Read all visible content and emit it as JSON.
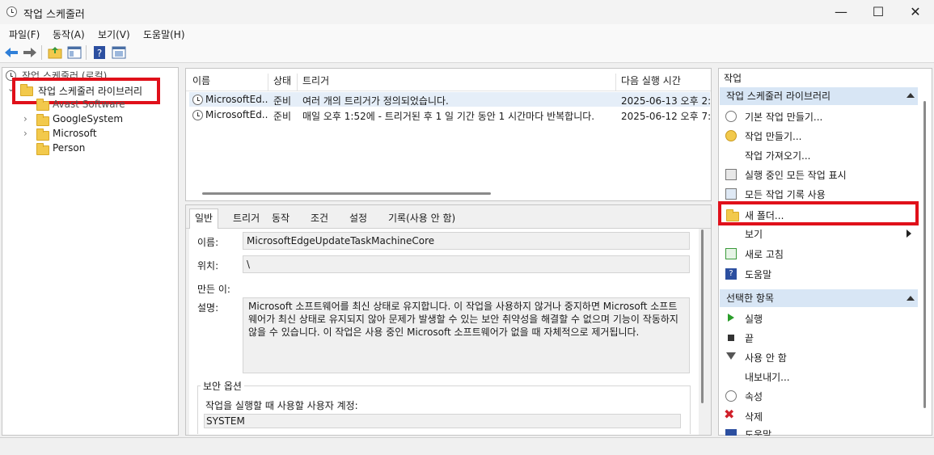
{
  "window": {
    "title": "작업 스케줄러",
    "controls": {
      "minimize": "—",
      "maximize": "☐",
      "close": "✕"
    }
  },
  "menu": [
    "파일(F)",
    "동작(A)",
    "보기(V)",
    "도움말(H)"
  ],
  "toolbar": {
    "icons": [
      "back-arrow-icon",
      "forward-arrow-icon",
      "folder-up-icon",
      "properties-icon",
      "help-icon",
      "view-icon"
    ]
  },
  "tree": {
    "root": "작업 스케줄러 (로컬)",
    "library": "작업 스케줄러 라이브러리",
    "children": [
      "Avast Software",
      "GoogleSystem",
      "Microsoft",
      "Person"
    ]
  },
  "task_list": {
    "columns": [
      "이름",
      "상태",
      "트리거",
      "다음 실행 시간"
    ],
    "rows": [
      {
        "name": "MicrosoftEd...",
        "status": "준비",
        "trigger": "여러 개의 트리거가 정의되었습니다.",
        "next_run": "2025-06-13 오후 2:2"
      },
      {
        "name": "MicrosoftEd...",
        "status": "준비",
        "trigger": "매일 오후 1:52에 - 트리거된 후 1 일 기간 동안 1 시간마다 반복합니다.",
        "next_run": "2025-06-12 오후 7:5"
      }
    ]
  },
  "detail": {
    "tabs": [
      "일반",
      "트리거",
      "동작",
      "조건",
      "설정",
      "기록(사용 안 함)"
    ],
    "labels": {
      "name": "이름:",
      "location": "위치:",
      "author": "만든 이:",
      "description": "설명:"
    },
    "name_value": "MicrosoftEdgeUpdateTaskMachineCore",
    "location_value": "\\",
    "description_value": "Microsoft 소프트웨어를 최신 상태로 유지합니다. 이 작업을 사용하지 않거나 중지하면 Microsoft 소프트웨어가 최신 상태로 유지되지 않아 문제가 발생할 수 있는 보안 취약성을 해결할 수 없으며 기능이 작동하지 않을 수 있습니다. 이 작업은 사용 중인 Microsoft 소프트웨어가 없을 때 자체적으로 제거됩니다.",
    "security_group": "보안 옵션",
    "run_as_label": "작업을 실행할 때 사용할 사용자 계정:",
    "run_as_value": "SYSTEM"
  },
  "actions": {
    "title": "작업",
    "section1": "작업 스케줄러 라이브러리",
    "items1": [
      "기본 작업 만들기...",
      "작업 만들기...",
      "작업 가져오기...",
      "실행 중인 모든 작업 표시",
      "모든 작업 기록 사용",
      "새 폴더...",
      "보기",
      "새로 고침",
      "도움말"
    ],
    "section2": "선택한 항목",
    "items2": [
      "실행",
      "끝",
      "사용 안 함",
      "내보내기...",
      "속성",
      "삭제",
      "도움말"
    ]
  },
  "colors": {
    "highlight": "#e0101a",
    "section_header": "#d8e6f5"
  }
}
